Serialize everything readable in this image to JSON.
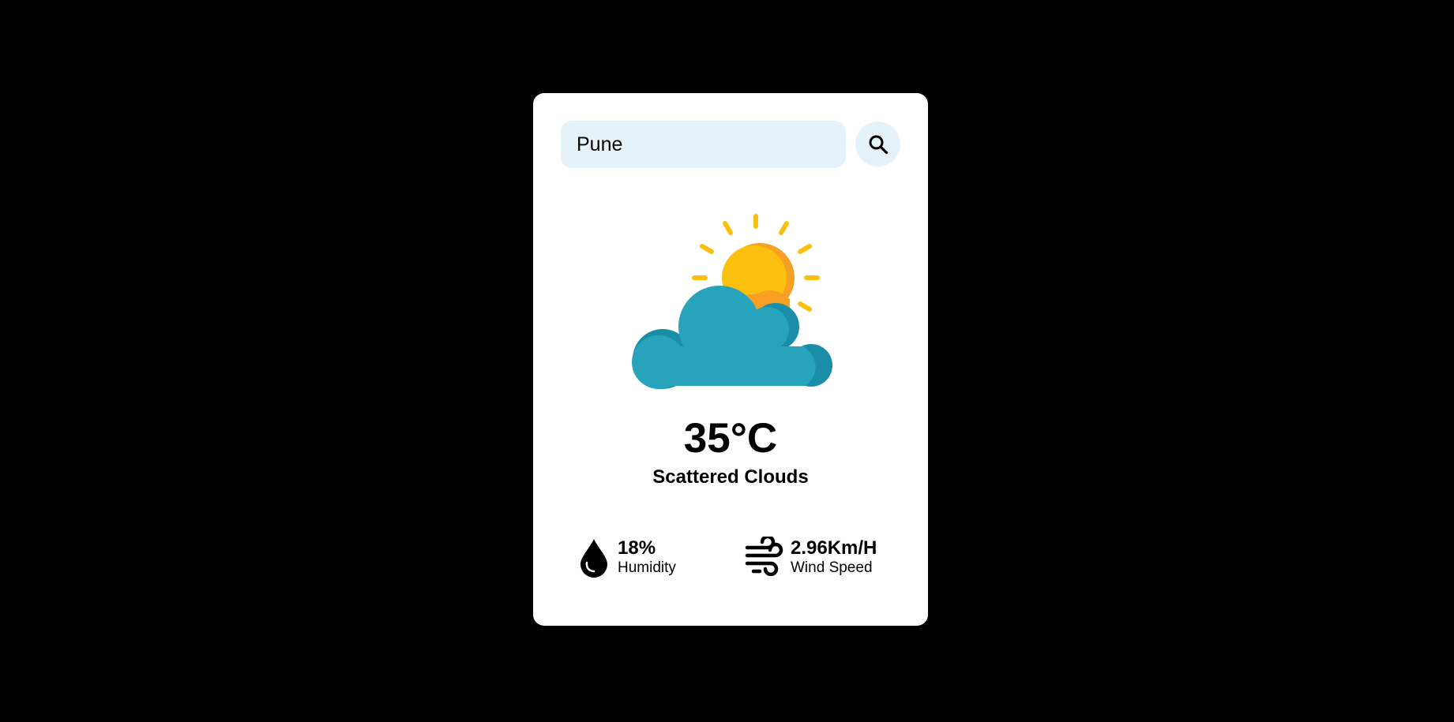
{
  "search": {
    "value": "Pune",
    "button_icon": "search-icon"
  },
  "weather": {
    "icon": "sun-behind-cloud-icon",
    "temperature": "35°C",
    "description": "Scattered Clouds"
  },
  "stats": {
    "humidity": {
      "icon": "water-drop-icon",
      "value": "18%",
      "label": "Humidity"
    },
    "wind": {
      "icon": "wind-icon",
      "value": "2.96Km/H",
      "label": "Wind Speed"
    }
  },
  "colors": {
    "page_background": "#000000",
    "card_background": "#ffffff",
    "input_background": "#e6f2f9",
    "sun": "#fbbf0e",
    "sun_shade": "#f7a024",
    "cloud": "#28a3bc",
    "cloud_shade": "#1a8ea6"
  }
}
